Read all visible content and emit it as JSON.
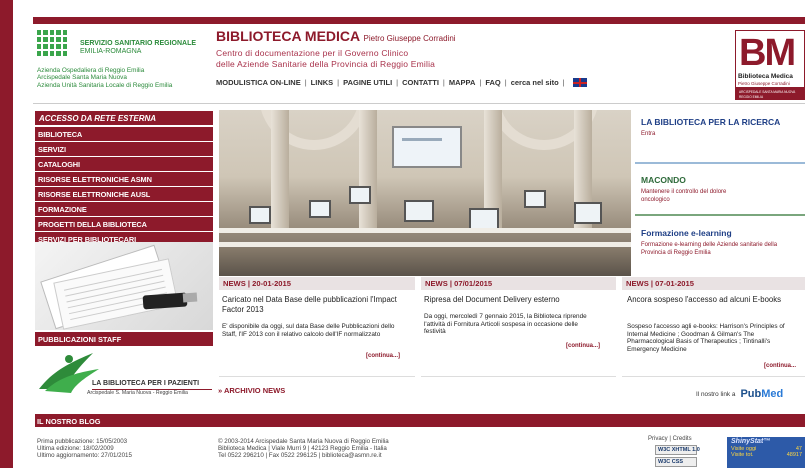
{
  "header": {
    "ssr_line1": "SERVIZIO SANITARIO REGIONALE",
    "ssr_line2": "EMILIA-ROMAGNA",
    "aus_lines": [
      "Azienda Ospedaliera di Reggio Emilia",
      "Arcispedale Santa Maria Nuova",
      "Azienda Unità Sanitaria Locale di Reggio Emilia"
    ],
    "title": "BIBLIOTECA MEDICA",
    "title_suffix": "Pietro Giuseppe Corradini",
    "subtitle_1": "Centro di documentazione per il Governo Clinico",
    "subtitle_2": "delle Aziende Sanitarie della Provincia di Reggio Emilia",
    "nav": [
      "MODULISTICA ON-LINE",
      "LINKS",
      "PAGINE UTILI",
      "CONTATTI",
      "MAPPA",
      "FAQ",
      "cerca nel sito"
    ],
    "nav_sep": "|",
    "bm_logo": {
      "letters": "BM",
      "line1": "Biblioteca Medica",
      "line2": "Pietro Giuseppe Corradini",
      "line3": "ARCISPEDALE SANTA MARIA NUOVA",
      "line4": "REGGIO EMILIA"
    }
  },
  "sidebar": {
    "header": "ACCESSO DA RETE ESTERNA",
    "items": [
      "BIBLIOTECA",
      "SERVIZI",
      "CATALOGHI",
      "RISORSE ELETTRONICHE ASMN",
      "RISORSE ELETTRONICHE AUSL",
      "FORMAZIONE",
      "PROGETTI DELLA BIBLIOTECA",
      "SERVIZI PER BIBLIOTECARI"
    ],
    "staff_header": "PUBBLICAZIONI STAFF",
    "bpr_title": "LA BIBLIOTECA PER I PAZIENTI",
    "bpr_sub": "Arcispedale S. Maria Nuova - Reggio Emilia"
  },
  "promos": [
    {
      "title": "LA BIBLIOTECA PER LA RICERCA",
      "desc": "Entra"
    },
    {
      "title": "MACONDO",
      "desc": "Mantenere il controllo del dolore oncologico"
    },
    {
      "title": "Formazione e-learning",
      "desc": "Formazione e-learning delle Aziende sanitarie della Provincia di Reggio Emilia"
    }
  ],
  "news": [
    {
      "date": "NEWS | 20-01-2015",
      "title": "Caricato nel Data Base delle pubblicazioni l'Impact Factor 2013",
      "body": "E' disponibile da oggi, sul data Base delle Pubblicazioni dello Staff, l'IF 2013 con il relativo calcolo dell'IF normalizzato",
      "more": "[continua...]"
    },
    {
      "date": "NEWS | 07/01/2015",
      "title": "Ripresa del Document Delivery esterno",
      "body": "Da oggi, mercoledì 7 gennaio 2015, la Biblioteca riprende l'attività di Fornitura Articoli sospesa in occasione delle festività",
      "more": "[continua...]"
    },
    {
      "date": "NEWS | 07-01-2015",
      "title": "Ancora sospeso l'accesso ad alcuni E-books",
      "body": "Sospeso l'accesso agli e-books: Harrison's Principles of Internal Medicine ; Goodman & Gilman's The Pharmacological Basis of Therapeutics ; Tintinalli's Emergency Medicine",
      "more": "[continua..."
    }
  ],
  "archive": "» ARCHIVIO NEWS",
  "pubmed": {
    "text": "Il nostro link a",
    "logo_a": "Pub",
    "logo_b": "Med"
  },
  "blog": "IL NOSTRO BLOG",
  "footer": {
    "dates": [
      "Prima pubblicazione: 15/05/2003",
      "Ultima edizione: 18/02/2009",
      "Ultimo aggiornamento: 27/01/2015"
    ],
    "contacts": [
      "© 2003-2014 Arcispedale Santa Maria Nuova di Reggio Emilia",
      "Biblioteca Medica | Viale Murri 9 | 42123 Reggio Emilia - Italia",
      "Tel 0522 296210 | Fax 0522 296125 | biblioteca@asmn.re.it"
    ],
    "privacy": "Privacy | Credits",
    "w3c_1": "W3C XHTML 1.0",
    "w3c_2": "W3C CSS",
    "shiny_title": "ShinyStat™",
    "shiny_today_label": "Visite oggi",
    "shiny_today_value": "47",
    "shiny_total_label": "Visite tot.",
    "shiny_total_value": "48917"
  }
}
